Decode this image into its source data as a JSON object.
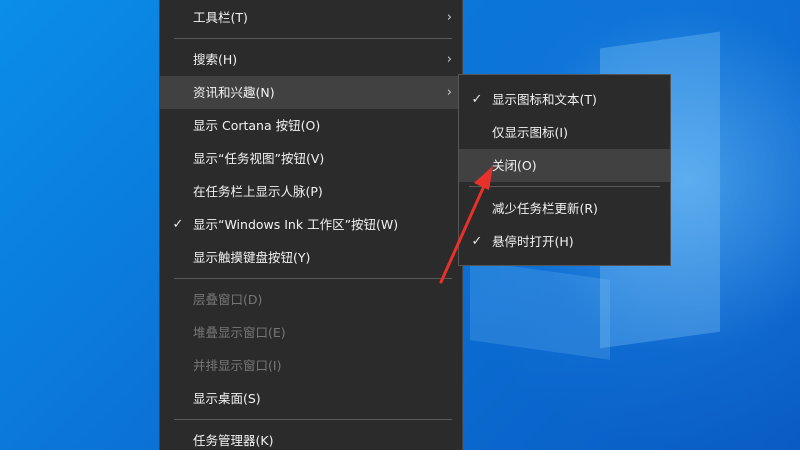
{
  "colors": {
    "menu_bg": "#2b2b2b",
    "menu_hover": "#414141",
    "text": "#f2f2f2",
    "text_disabled": "#777777",
    "desktop_blue": "#0b73d6",
    "annotation_red": "#e8312a"
  },
  "context_menu": {
    "items": [
      {
        "label": "工具栏(T)",
        "submenu_arrow": "›"
      },
      {
        "label": "搜索(H)",
        "submenu_arrow": "›"
      },
      {
        "label": "资讯和兴趣(N)",
        "submenu_arrow": "›"
      },
      {
        "label": "显示 Cortana 按钮(O)"
      },
      {
        "label": "显示“任务视图”按钮(V)"
      },
      {
        "label": "在任务栏上显示人脉(P)"
      },
      {
        "label": "显示“Windows Ink 工作区”按钮(W)",
        "check": "✓"
      },
      {
        "label": "显示触摸键盘按钮(Y)"
      },
      {
        "label": "层叠窗口(D)"
      },
      {
        "label": "堆叠显示窗口(E)"
      },
      {
        "label": "并排显示窗口(I)"
      },
      {
        "label": "显示桌面(S)"
      },
      {
        "label": "任务管理器(K)"
      }
    ]
  },
  "submenu": {
    "items": [
      {
        "label": "显示图标和文本(T)",
        "check": "✓"
      },
      {
        "label": "仅显示图标(I)"
      },
      {
        "label": "关闭(O)"
      },
      {
        "label": "减少任务栏更新(R)"
      },
      {
        "label": "悬停时打开(H)",
        "check": "✓"
      }
    ]
  }
}
